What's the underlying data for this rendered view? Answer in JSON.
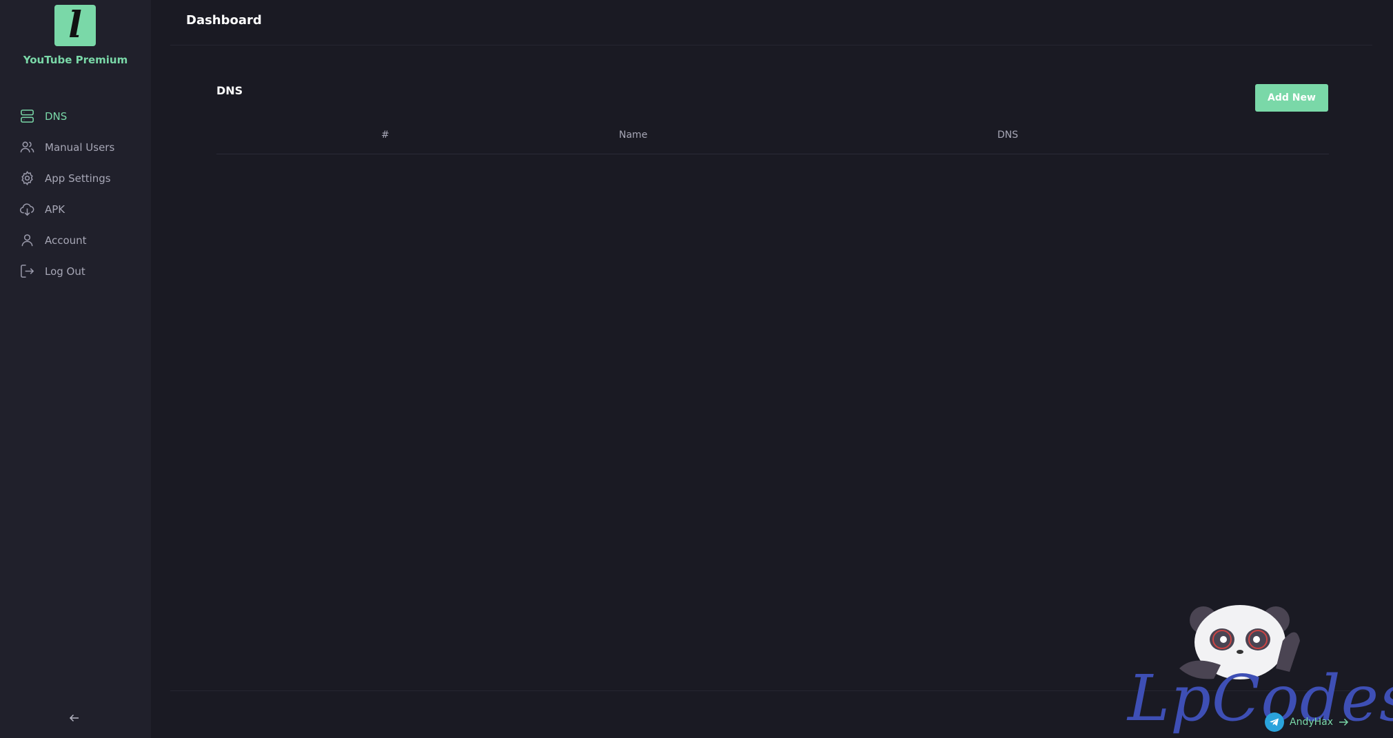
{
  "brand": {
    "name": "YouTube Premium",
    "logo_letter": "l",
    "accent": "#7ad8a8"
  },
  "sidebar": {
    "items": [
      {
        "label": "DNS",
        "icon": "server-icon",
        "active": true
      },
      {
        "label": "Manual Users",
        "icon": "users-icon",
        "active": false
      },
      {
        "label": "App Settings",
        "icon": "gear-icon",
        "active": false
      },
      {
        "label": "APK",
        "icon": "cloud-download-icon",
        "active": false
      },
      {
        "label": "Account",
        "icon": "user-icon",
        "active": false
      },
      {
        "label": "Log Out",
        "icon": "logout-icon",
        "active": false
      }
    ],
    "collapse_icon": "arrow-left-icon"
  },
  "header": {
    "title": "Dashboard"
  },
  "card": {
    "title": "DNS",
    "add_button": "Add New",
    "columns": [
      "#",
      "Name",
      "DNS"
    ],
    "rows": []
  },
  "watermark": {
    "text": "LpCodes",
    "handle": "AndyHax",
    "icon": "telegram-icon"
  }
}
